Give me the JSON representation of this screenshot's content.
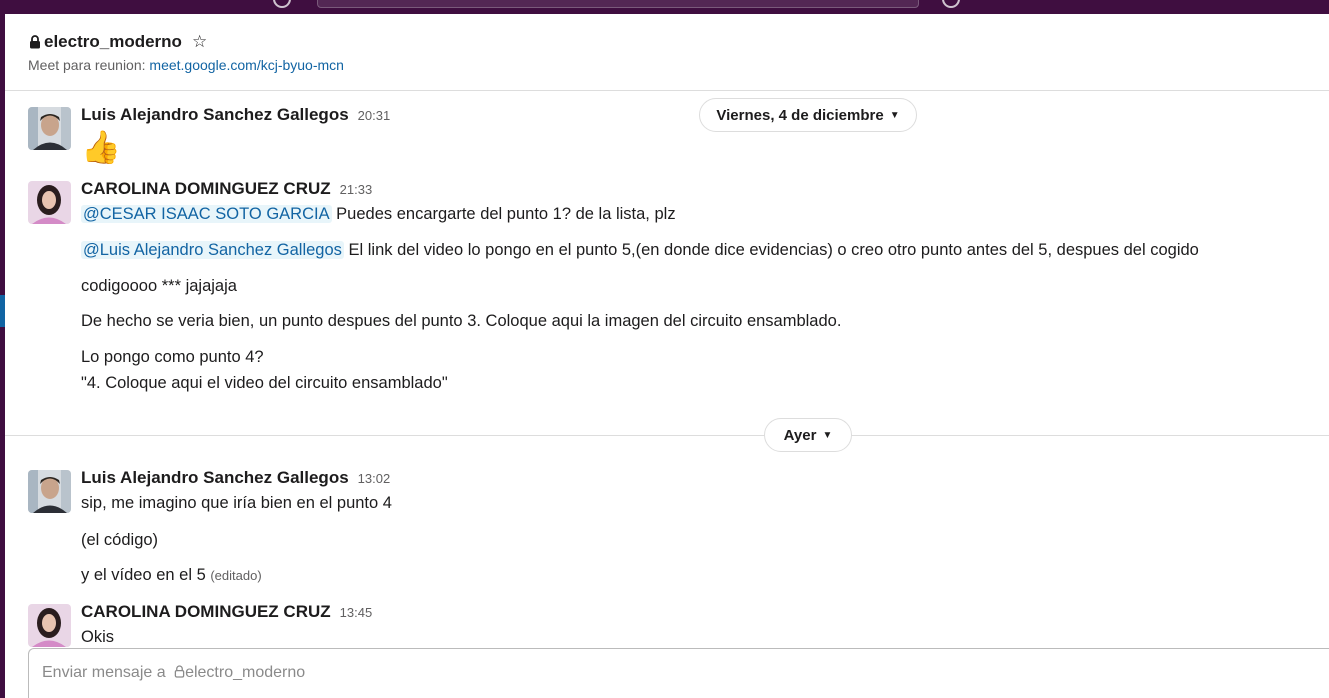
{
  "channel": {
    "name": "electro_moderno",
    "topic_label": "Meet para reunion:",
    "topic_link": "meet.google.com/kcj-byuo-mcn"
  },
  "dividers": [
    {
      "label": "Viernes, 4 de diciembre"
    },
    {
      "label": "Ayer"
    }
  ],
  "messages": [
    {
      "author": "Luis Alejandro Sanchez Gallegos",
      "time": "20:31",
      "emoji": "👍"
    },
    {
      "author": "CAROLINA DOMINGUEZ CRUZ",
      "time": "21:33",
      "lines": [
        {
          "mention": "@CESAR ISAAC SOTO GARCIA",
          "text": " Puedes encargarte del punto 1? de la lista, plz"
        },
        {
          "mention": "@Luis Alejandro Sanchez Gallegos",
          "text": " El link del video lo pongo en el punto 5,(en donde dice evidencias) o creo otro punto antes del 5, despues del cogido"
        },
        {
          "text": "codigoooo *** jajajaja"
        },
        {
          "text": "De hecho se veria bien, un punto despues del punto 3. Coloque aqui la imagen del circuito ensamblado."
        },
        {
          "text": "Lo pongo como punto 4?"
        },
        {
          "text": "\"4. Coloque aqui el video del circuito ensamblado\""
        }
      ]
    },
    {
      "author": "Luis Alejandro Sanchez Gallegos",
      "time": "13:02",
      "lines": [
        {
          "text": "sip, me imagino que iría bien en el punto 4"
        },
        {
          "text": "(el código)"
        },
        {
          "text": "y el vídeo en el 5",
          "edited": "(editado)"
        }
      ]
    },
    {
      "author": "CAROLINA DOMINGUEZ CRUZ",
      "time": "13:45",
      "lines": [
        {
          "text": "Okis"
        }
      ]
    }
  ],
  "composer": {
    "placeholder_prefix": "Enviar mensaje a",
    "placeholder_channel": "electro_moderno"
  },
  "colors": {
    "sidebar": "#3f0e40",
    "link": "#1264a3",
    "mention_bg": "#e8f5fa"
  }
}
